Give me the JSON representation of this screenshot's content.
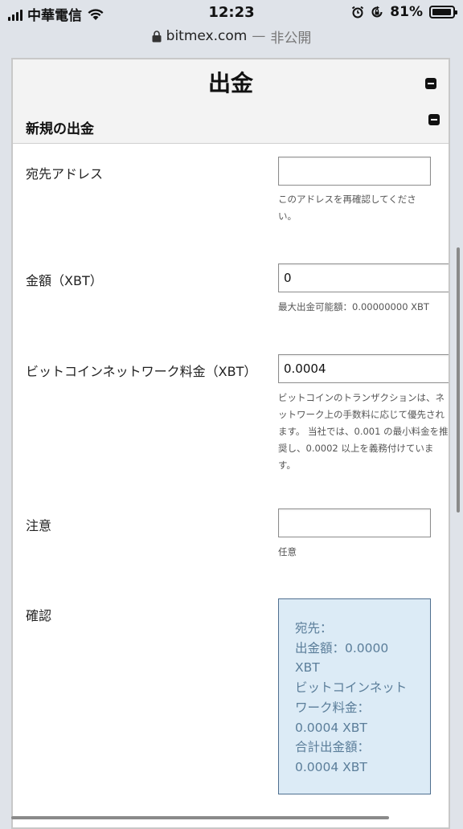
{
  "status_bar": {
    "carrier": "中華電信",
    "time": "12:23",
    "battery_percent": "81%",
    "battery_level": 0.81
  },
  "url_bar": {
    "domain": "bitmex.com",
    "separator": "—",
    "privacy": "非公開"
  },
  "page": {
    "title": "出金",
    "section_title": "新規の出金"
  },
  "form": {
    "address": {
      "label": "宛先アドレス",
      "value": "",
      "help_line1": "このアドレスを再確認してくださ",
      "help_line2": "い。"
    },
    "amount": {
      "label": "金額（XBT）",
      "value": "0",
      "help": "最大出金可能額：0.00000000 XBT"
    },
    "fee": {
      "label": "ビットコインネットワーク料金（XBT）",
      "value": "0.0004",
      "help_lines": [
        "ビットコインのトランザクションは、ネ",
        "ットワーク上の手数料に応じて優先され",
        "ます。 当社では、0.001 の最小料金を推",
        "奨し、0.0002 以上を義務付けていま",
        "す。"
      ]
    },
    "memo": {
      "label": "注意",
      "value": "",
      "help": "任意"
    },
    "confirm": {
      "label": "確認",
      "lines": [
        "宛先：",
        "出金額：0.0000",
        "XBT",
        "ビットコインネット",
        "ワーク料金：",
        "0.0004 XBT",
        "合計出金額：",
        "0.0004 XBT"
      ]
    }
  },
  "icons": {
    "wifi": "wifi-icon",
    "lock": "lock-icon",
    "alarm": "alarm-icon",
    "rotation_lock": "rotation-lock-icon",
    "battery": "battery-icon",
    "collapse": "collapse-icon"
  }
}
